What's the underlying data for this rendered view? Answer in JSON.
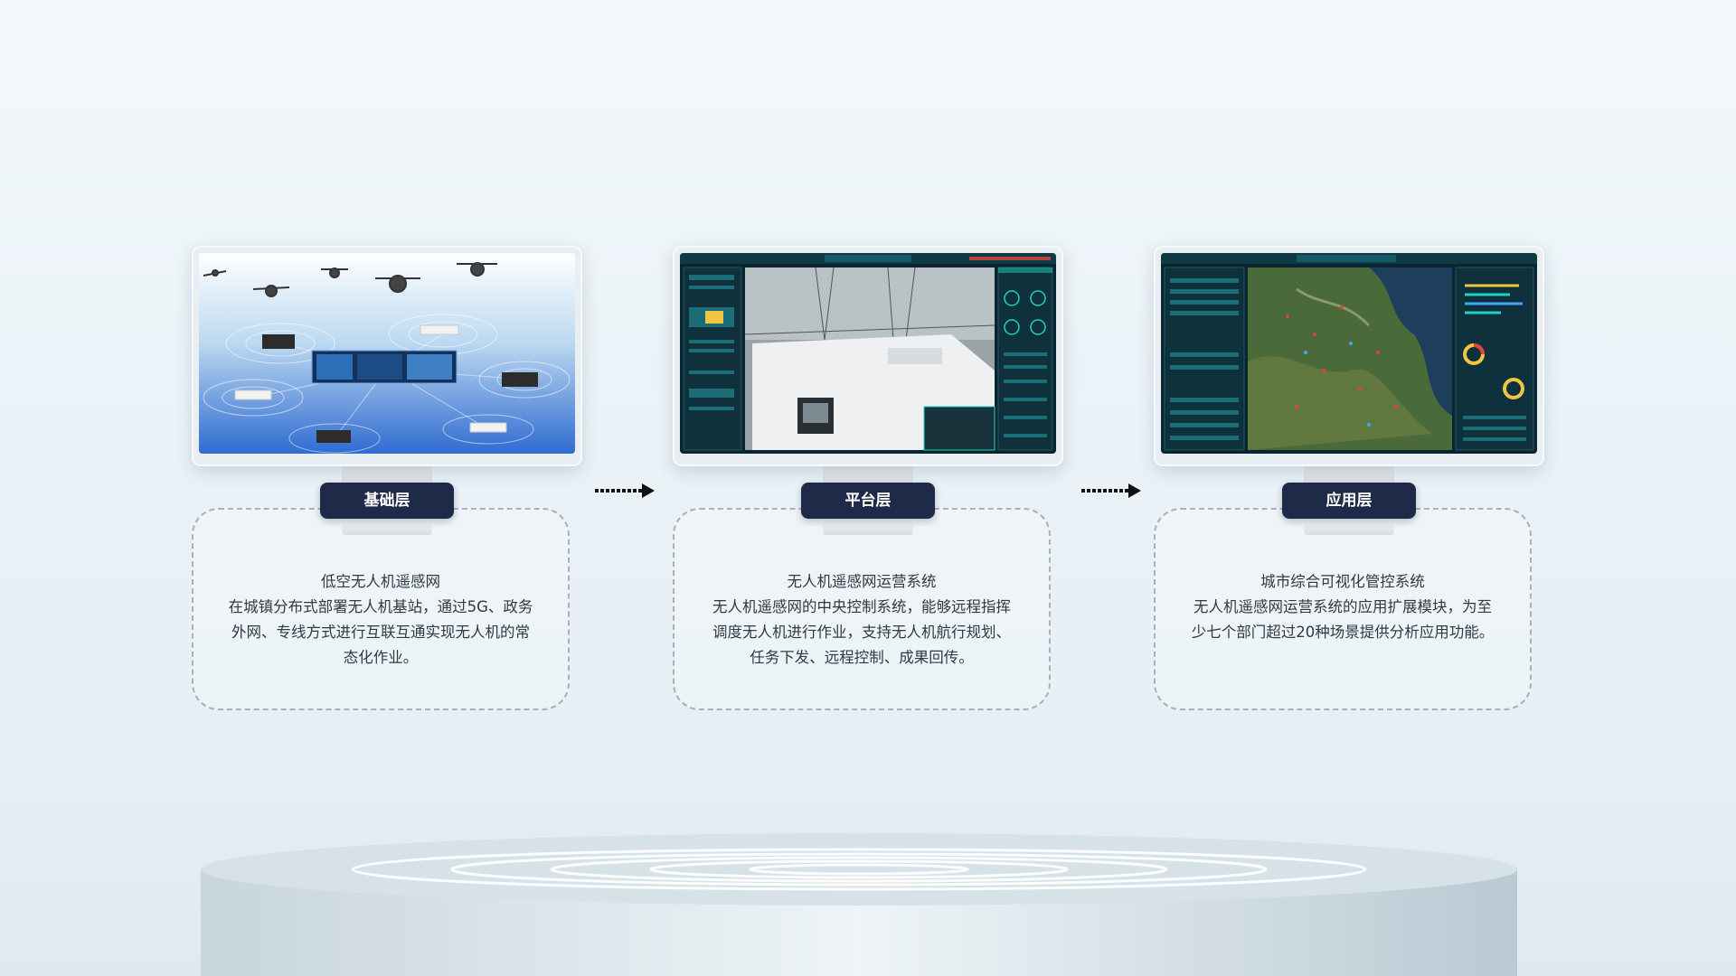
{
  "layers": [
    {
      "tag": "基础层",
      "title": "低空无人机遥感网",
      "description": "在城镇分布式部署无人机基站，通过5G、政务\n外网、专线方式进行互联互通实现无人机的常\n态化作业。"
    },
    {
      "tag": "平台层",
      "title": "无人机遥感网运营系统",
      "description": "无人机遥感网的中央控制系统，能够远程指挥\n调度无人机进行作业，支持无人机航行规划、\n任务下发、远程控制、成果回传。"
    },
    {
      "tag": "应用层",
      "title": "城市综合可视化管控系统",
      "description": "无人机遥感网运营系统的应用扩展模块，为至\n少七个部门超过20种场景提供分析应用功能。"
    }
  ],
  "colors": {
    "tag_bg": "#1f2a48",
    "dashed_border": "#a9b1b8",
    "screen_dark": "#0d2b33",
    "screen_accent": "#1fd1c1"
  }
}
